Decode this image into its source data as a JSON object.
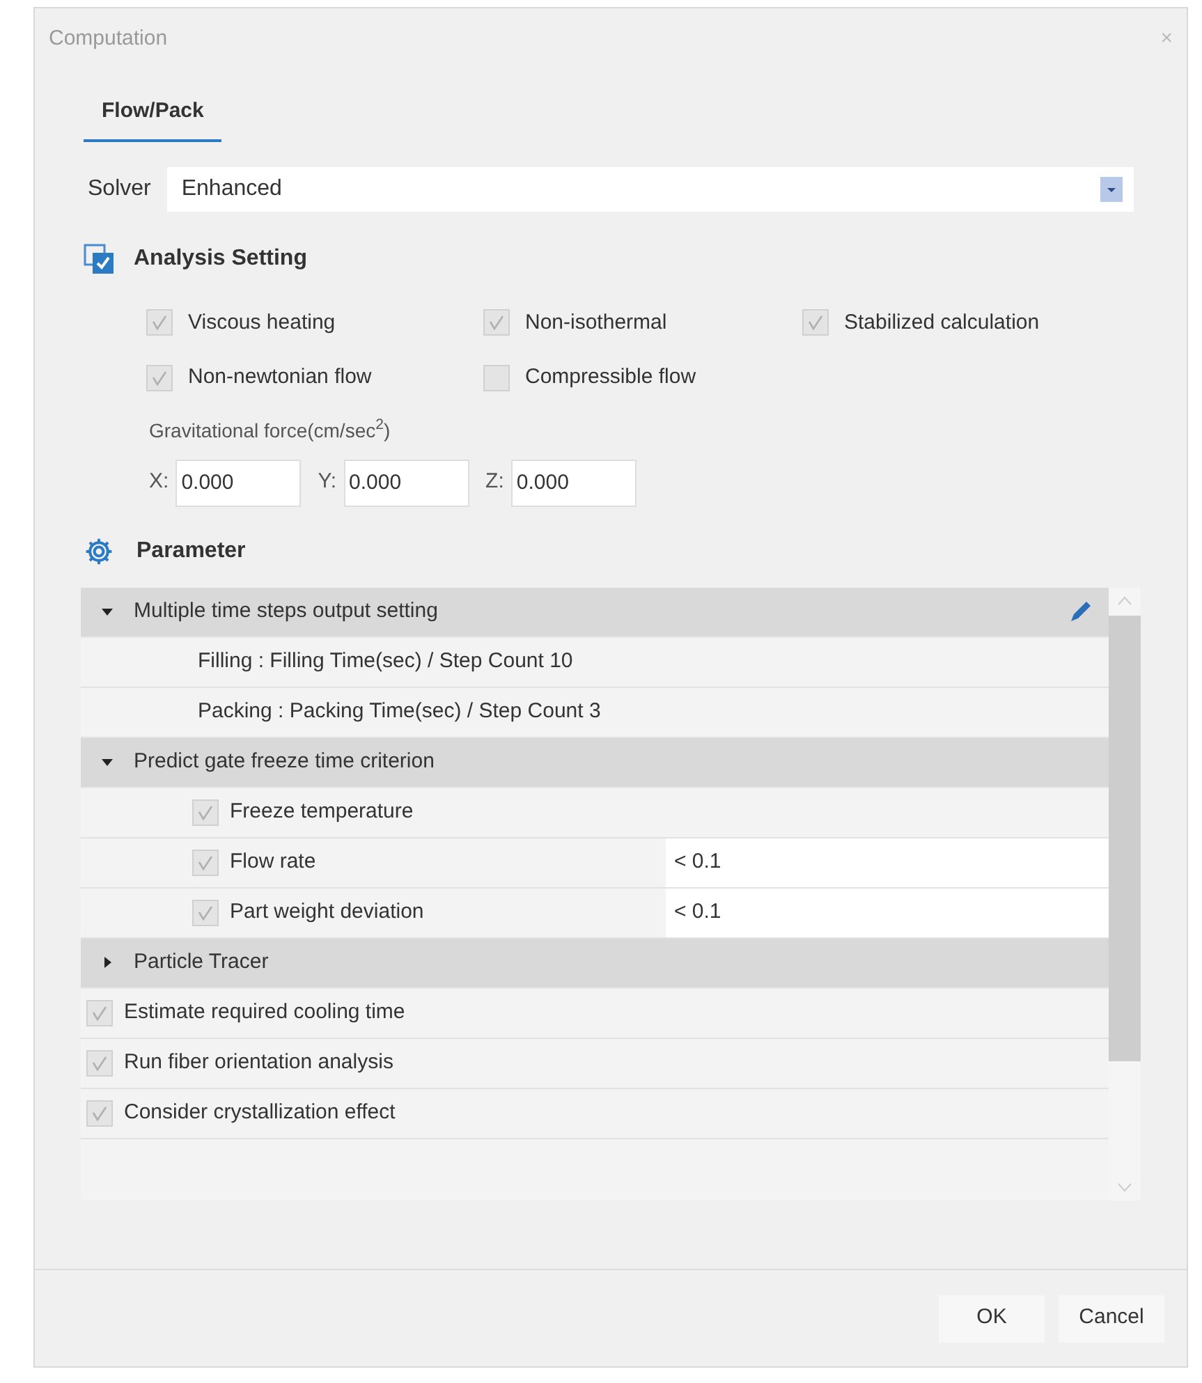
{
  "window": {
    "title": "Computation",
    "close": "×"
  },
  "tabs": [
    {
      "label": "Flow/Pack",
      "selected": true
    }
  ],
  "solver": {
    "label": "Solver",
    "value": "Enhanced"
  },
  "analysis_setting": {
    "title": "Analysis Setting",
    "checked": true,
    "options": [
      [
        {
          "label": "Viscous heating",
          "checked": true
        },
        {
          "label": "Non-isothermal",
          "checked": true
        },
        {
          "label": "Stabilized calculation",
          "checked": true
        }
      ],
      [
        {
          "label": "Non-newtonian flow",
          "checked": true
        },
        {
          "label": "Compressible flow",
          "checked": false
        }
      ]
    ],
    "gravity": {
      "label": "Gravitational force(cm/sec$^{2}$)",
      "fields": [
        {
          "label": "X:",
          "value": "0.000"
        },
        {
          "label": "Y:",
          "value": "0.000"
        },
        {
          "label": "Z:",
          "value": "0.000"
        }
      ]
    }
  },
  "parameter": {
    "title": "Parameter",
    "rows": [
      {
        "kind": "group",
        "label": "Multiple time steps output setting",
        "expanded": true,
        "editable": true
      },
      {
        "kind": "text",
        "label": "Filling : Filling Time(sec) / Step Count 10"
      },
      {
        "kind": "text",
        "label": "Packing : Packing Time(sec) / Step Count 3"
      },
      {
        "kind": "group",
        "label": "Predict gate freeze time criterion",
        "expanded": true,
        "editable": false
      },
      {
        "kind": "subcheck",
        "label": "Freeze temperature",
        "checked": true
      },
      {
        "kind": "subcheck",
        "label": "Flow rate",
        "checked": true,
        "value": "< 0.1"
      },
      {
        "kind": "subcheck",
        "label": "Part weight deviation",
        "checked": true,
        "value": "< 0.1"
      },
      {
        "kind": "group",
        "label": "Particle Tracer",
        "expanded": false,
        "editable": false
      },
      {
        "kind": "check",
        "label": "Estimate required cooling time",
        "checked": true
      },
      {
        "kind": "check",
        "label": "Run fiber orientation analysis",
        "checked": true
      },
      {
        "kind": "check",
        "label": "Consider crystallization effect",
        "checked": true
      }
    ]
  },
  "buttons": [
    "OK",
    "Cancel"
  ]
}
